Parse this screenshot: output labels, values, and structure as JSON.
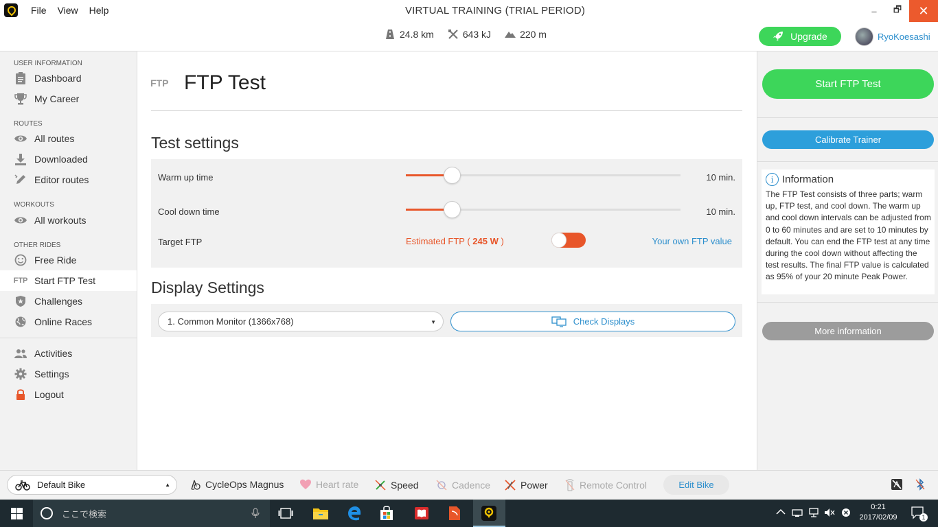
{
  "window": {
    "title": "VIRTUAL TRAINING (TRIAL PERIOD)",
    "menu": [
      "File",
      "View",
      "Help"
    ],
    "controls": {
      "minimize": "–",
      "restore": "🗗",
      "close": "✕"
    }
  },
  "header": {
    "stats": [
      {
        "icon": "road-icon",
        "value": "24.8 km"
      },
      {
        "icon": "fork-knife-icon",
        "value": "643 kJ"
      },
      {
        "icon": "mountain-icon",
        "value": "220 m"
      }
    ],
    "upgrade_label": "Upgrade",
    "username": "RyoKoesashi"
  },
  "sidebar": {
    "sections": {
      "user": "USER INFORMATION",
      "routes": "ROUTES",
      "workouts": "WORKOUTS",
      "other": "OTHER RIDES"
    },
    "items": {
      "dashboard": "Dashboard",
      "career": "My Career",
      "all_routes": "All routes",
      "downloaded": "Downloaded",
      "editor_routes": "Editor routes",
      "all_workouts": "All workouts",
      "free_ride": "Free Ride",
      "start_ftp": "Start FTP Test",
      "start_ftp_tag": "FTP",
      "challenges": "Challenges",
      "online_races": "Online Races",
      "activities": "Activities",
      "settings": "Settings",
      "logout": "Logout"
    }
  },
  "main": {
    "tag": "FTP",
    "title": "FTP Test",
    "test_settings": {
      "heading": "Test settings",
      "warmup": {
        "label": "Warm up time",
        "value": "10 min.",
        "fraction": 0.1667
      },
      "cooldown": {
        "label": "Cool down time",
        "value": "10 min.",
        "fraction": 0.1667
      },
      "target": {
        "label": "Target FTP",
        "estimated_prefix": "Estimated FTP ( ",
        "estimated_value": "245 W",
        "estimated_suffix": " )",
        "own_value_label": "Your own FTP value"
      }
    },
    "display_settings": {
      "heading": "Display Settings",
      "monitor_selected": "1. Common Monitor (1366x768)",
      "check_displays": "Check Displays"
    }
  },
  "right_panel": {
    "start_button": "Start FTP Test",
    "calibrate_button": "Calibrate Trainer",
    "info_title": "Information",
    "info_text": "The FTP Test consists of three parts; warm up, FTP test, and cool down. The warm up and cool down intervals can be adjusted from 0 to 60 minutes and are set to 10 minutes by default. You can end the FTP test at any time during the cool down without affecting the test results. The final FTP value is calculated as 95% of your 20 minute Peak Power.",
    "more_button": "More information"
  },
  "devices": {
    "bike": "Default Bike",
    "trainer": "CycleOps Magnus",
    "heart_rate": "Heart rate",
    "speed": "Speed",
    "cadence": "Cadence",
    "power": "Power",
    "remote": "Remote Control",
    "edit_bike": "Edit Bike"
  },
  "taskbar": {
    "search_placeholder": "ここで検索",
    "time": "0:21",
    "date": "2017/02/09",
    "notification_count": "1"
  },
  "colors": {
    "accent_green": "#3dd65a",
    "accent_orange": "#e8562a",
    "accent_blue": "#2d8fcd"
  }
}
